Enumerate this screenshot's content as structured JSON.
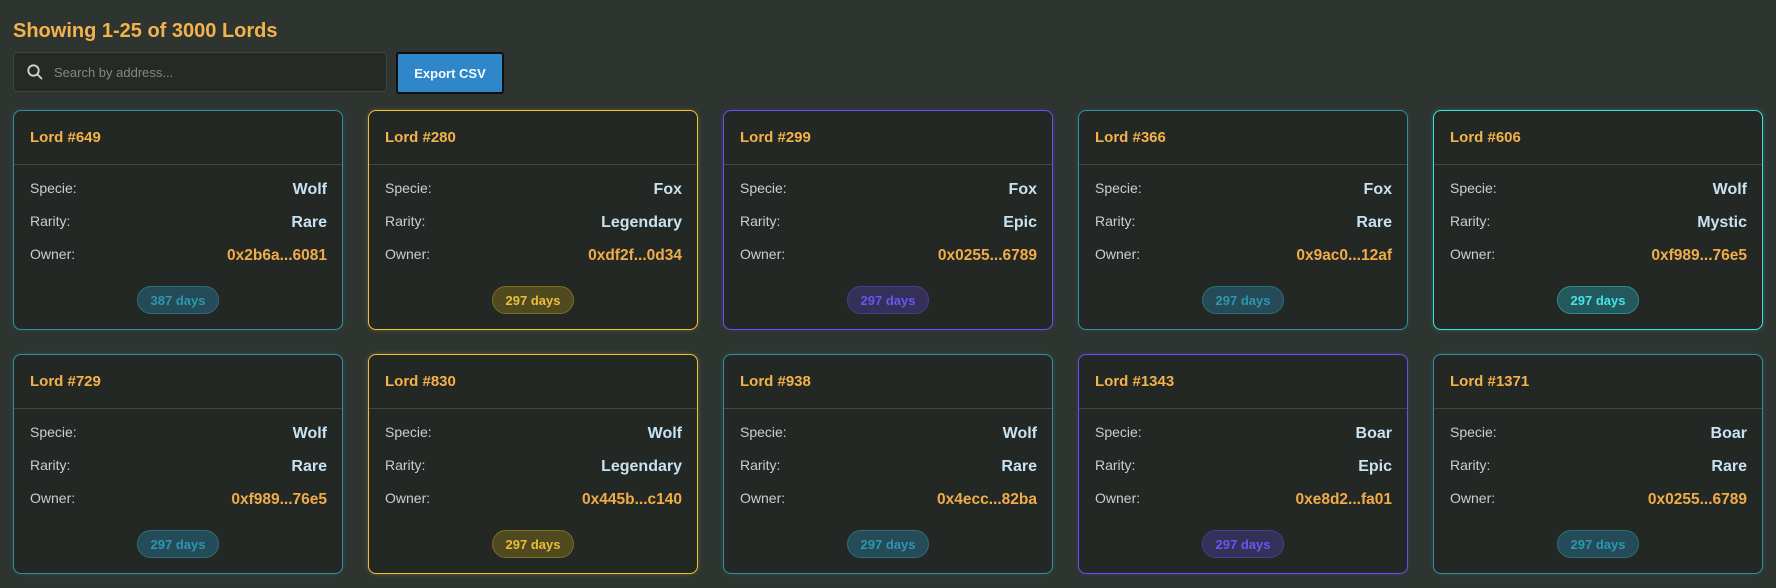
{
  "summary": {
    "text": "Showing 1-25 of 3000 Lords"
  },
  "search": {
    "placeholder": "Search by address..."
  },
  "toolbar": {
    "export_label": "Export CSV"
  },
  "labels": {
    "specie": "Specie:",
    "rarity": "Rarity:",
    "owner": "Owner:"
  },
  "icons": {
    "search": "search-icon"
  },
  "colors": {
    "page_bg": "#2e3531",
    "accent": "#f4b24a",
    "button_bg": "#2f86c9",
    "rare_border": "#2f8a9b",
    "legendary_border": "#f0c12f",
    "epic_border": "#6d4df3",
    "mystic_border": "#39e2df"
  },
  "cards": [
    {
      "title": "Lord #649",
      "specie": "Wolf",
      "rarity": "Rare",
      "owner": "0x2b6a...6081",
      "days": "387 days",
      "theme": "rare"
    },
    {
      "title": "Lord #280",
      "specie": "Fox",
      "rarity": "Legendary",
      "owner": "0xdf2f...0d34",
      "days": "297 days",
      "theme": "legendary"
    },
    {
      "title": "Lord #299",
      "specie": "Fox",
      "rarity": "Epic",
      "owner": "0x0255...6789",
      "days": "297 days",
      "theme": "epic"
    },
    {
      "title": "Lord #366",
      "specie": "Fox",
      "rarity": "Rare",
      "owner": "0x9ac0...12af",
      "days": "297 days",
      "theme": "rare"
    },
    {
      "title": "Lord #606",
      "specie": "Wolf",
      "rarity": "Mystic",
      "owner": "0xf989...76e5",
      "days": "297 days",
      "theme": "mystic"
    },
    {
      "title": "Lord #729",
      "specie": "Wolf",
      "rarity": "Rare",
      "owner": "0xf989...76e5",
      "days": "297 days",
      "theme": "rare"
    },
    {
      "title": "Lord #830",
      "specie": "Wolf",
      "rarity": "Legendary",
      "owner": "0x445b...c140",
      "days": "297 days",
      "theme": "legendary"
    },
    {
      "title": "Lord #938",
      "specie": "Wolf",
      "rarity": "Rare",
      "owner": "0x4ecc...82ba",
      "days": "297 days",
      "theme": "rare"
    },
    {
      "title": "Lord #1343",
      "specie": "Boar",
      "rarity": "Epic",
      "owner": "0xe8d2...fa01",
      "days": "297 days",
      "theme": "epic"
    },
    {
      "title": "Lord #1371",
      "specie": "Boar",
      "rarity": "Rare",
      "owner": "0x0255...6789",
      "days": "297 days",
      "theme": "rare"
    }
  ]
}
